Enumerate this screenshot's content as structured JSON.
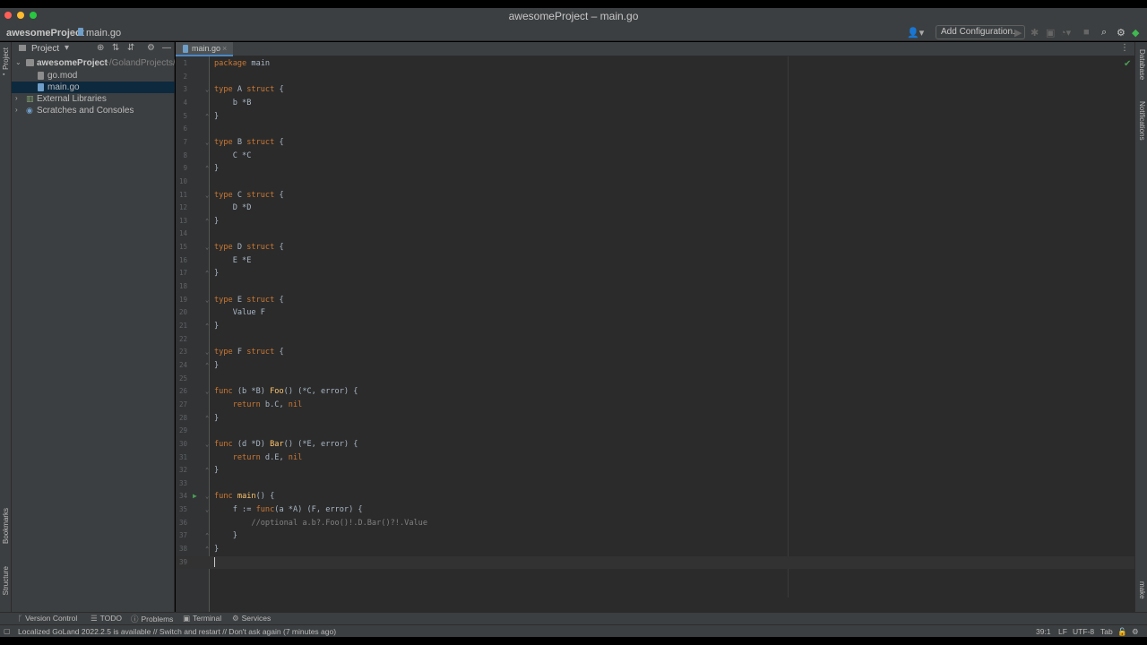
{
  "window": {
    "title": "awesomeProject – main.go"
  },
  "navbar": {
    "project": "awesomeProject",
    "file": "main.go",
    "add_configuration": "Add Configuration..."
  },
  "left_strip": {
    "project": "Project",
    "bookmarks": "Bookmarks",
    "structure": "Structure"
  },
  "right_strip": {
    "database": "Database",
    "notifications": "Notifications",
    "make": "make"
  },
  "project_panel": {
    "title": "Project",
    "tree": [
      {
        "label": "awesomeProject",
        "sub": "~/GolandProjects/aw"
      },
      {
        "label": "go.mod"
      },
      {
        "label": "main.go"
      },
      {
        "label": "External Libraries"
      },
      {
        "label": "Scratches and Consoles"
      }
    ]
  },
  "editor": {
    "tab": "main.go",
    "lines": [
      "package main",
      "",
      "type A struct {",
      "    b *B",
      "}",
      "",
      "type B struct {",
      "    C *C",
      "}",
      "",
      "type C struct {",
      "    D *D",
      "}",
      "",
      "type D struct {",
      "    E *E",
      "}",
      "",
      "type E struct {",
      "    Value F",
      "}",
      "",
      "type F struct {",
      "}",
      "",
      "func (b *B) Foo() (*C, error) {",
      "    return b.C, nil",
      "}",
      "",
      "func (d *D) Bar() (*E, error) {",
      "    return d.E, nil",
      "}",
      "",
      "func main() {",
      "    f := func(a *A) (F, error) {",
      "        //optional a.b?.Foo()!.D.Bar()?!.Value",
      "    }",
      "}",
      ""
    ],
    "line_numbers": [
      "1",
      "2",
      "3",
      "4",
      "5",
      "6",
      "7",
      "8",
      "9",
      "10",
      "11",
      "12",
      "13",
      "14",
      "15",
      "16",
      "17",
      "18",
      "19",
      "20",
      "21",
      "22",
      "23",
      "24",
      "25",
      "26",
      "27",
      "28",
      "29",
      "30",
      "31",
      "32",
      "33",
      "34",
      "35",
      "36",
      "37",
      "38",
      "39"
    ]
  },
  "tool_windows": {
    "version_control": "Version Control",
    "todo": "TODO",
    "problems": "Problems",
    "terminal": "Terminal",
    "services": "Services"
  },
  "status": {
    "message": "Localized GoLand 2022.2.5 is available // Switch and restart // Don't ask again (7 minutes ago)",
    "position": "39:1",
    "line_sep": "LF",
    "encoding": "UTF-8",
    "indent": "Tab"
  },
  "colors": {
    "keyword": "#cc7832",
    "function": "#ffc66d",
    "comment": "#808080",
    "text": "#a9b7c6",
    "selection": "#0d293e"
  }
}
